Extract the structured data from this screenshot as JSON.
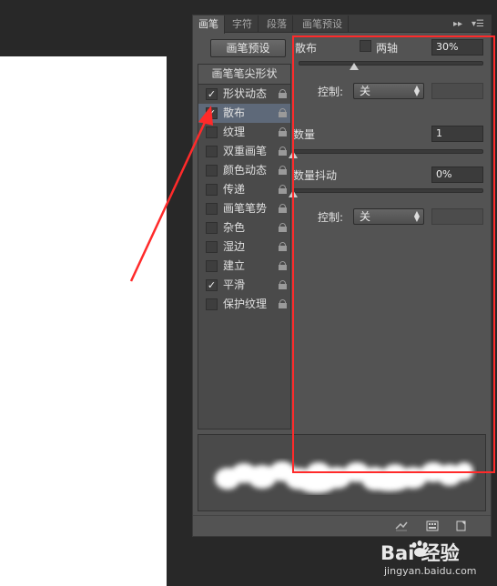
{
  "tabs": [
    {
      "label": "画笔",
      "active": true
    },
    {
      "label": "字符",
      "active": false
    },
    {
      "label": "段落",
      "active": false
    },
    {
      "label": "画笔预设",
      "active": false
    }
  ],
  "panel_controls": {
    "expand": "▸▸",
    "menu": "▾☰"
  },
  "preset_button": "画笔预设",
  "list_header": "画笔笔尖形状",
  "list_items": [
    {
      "label": "形状动态",
      "checked": "✓",
      "selected": false
    },
    {
      "label": "散布",
      "checked": "✓",
      "selected": true
    },
    {
      "label": "纹理",
      "checked": "",
      "selected": false
    },
    {
      "label": "双重画笔",
      "checked": "",
      "selected": false
    },
    {
      "label": "颜色动态",
      "checked": "",
      "selected": false
    },
    {
      "label": "传递",
      "checked": "",
      "selected": false
    },
    {
      "label": "画笔笔势",
      "checked": "",
      "selected": false
    },
    {
      "label": "杂色",
      "checked": "",
      "selected": false
    },
    {
      "label": "湿边",
      "checked": "",
      "selected": false
    },
    {
      "label": "建立",
      "checked": "",
      "selected": false
    },
    {
      "label": "平滑",
      "checked": "✓",
      "selected": false
    },
    {
      "label": "保护纹理",
      "checked": "",
      "selected": false
    }
  ],
  "scatter": {
    "label": "散布",
    "both_axes_label": "两轴",
    "value": "30%",
    "level": 0.3,
    "control_label": "控制:",
    "control_value": "关"
  },
  "count": {
    "label": "数量",
    "value": "1",
    "level": 0.0
  },
  "count_jitter": {
    "label": "数量抖动",
    "value": "0%",
    "level": 0.0,
    "control_label": "控制:",
    "control_value": "关"
  },
  "watermark": {
    "logo": "Bai 经验",
    "url": "jingyan.baidu.com"
  },
  "colors": {
    "highlight": "#ff2a2a",
    "panel_bg": "#535353",
    "selected_row": "#5e6979"
  }
}
